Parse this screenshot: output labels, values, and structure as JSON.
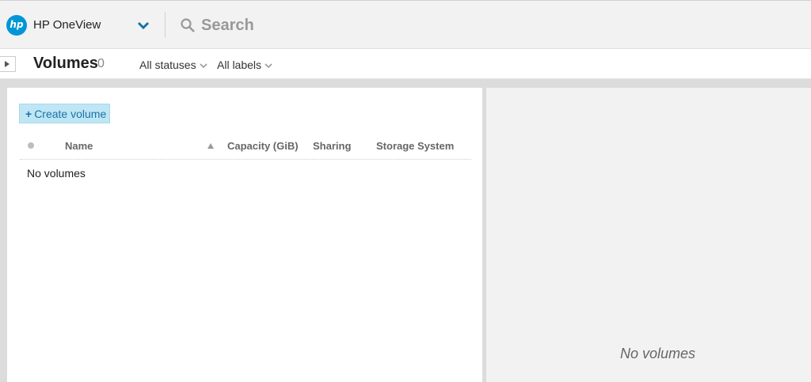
{
  "header": {
    "logo_text": "hp",
    "app_name": "HP OneView",
    "search_placeholder": "Search"
  },
  "subheader": {
    "title": "Volumes",
    "count": "0",
    "filters": [
      {
        "label": "All statuses"
      },
      {
        "label": "All labels"
      }
    ]
  },
  "master": {
    "create_button_label": "Create volume",
    "create_button_icon": "+",
    "columns": [
      "Name",
      "Capacity (GiB)",
      "Sharing",
      "Storage System"
    ],
    "empty_message": "No volumes"
  },
  "detail": {
    "empty_message": "No volumes"
  },
  "colors": {
    "brand": "#0096d6",
    "button_bg": "#bfe6f5",
    "button_text": "#1a73a8"
  }
}
